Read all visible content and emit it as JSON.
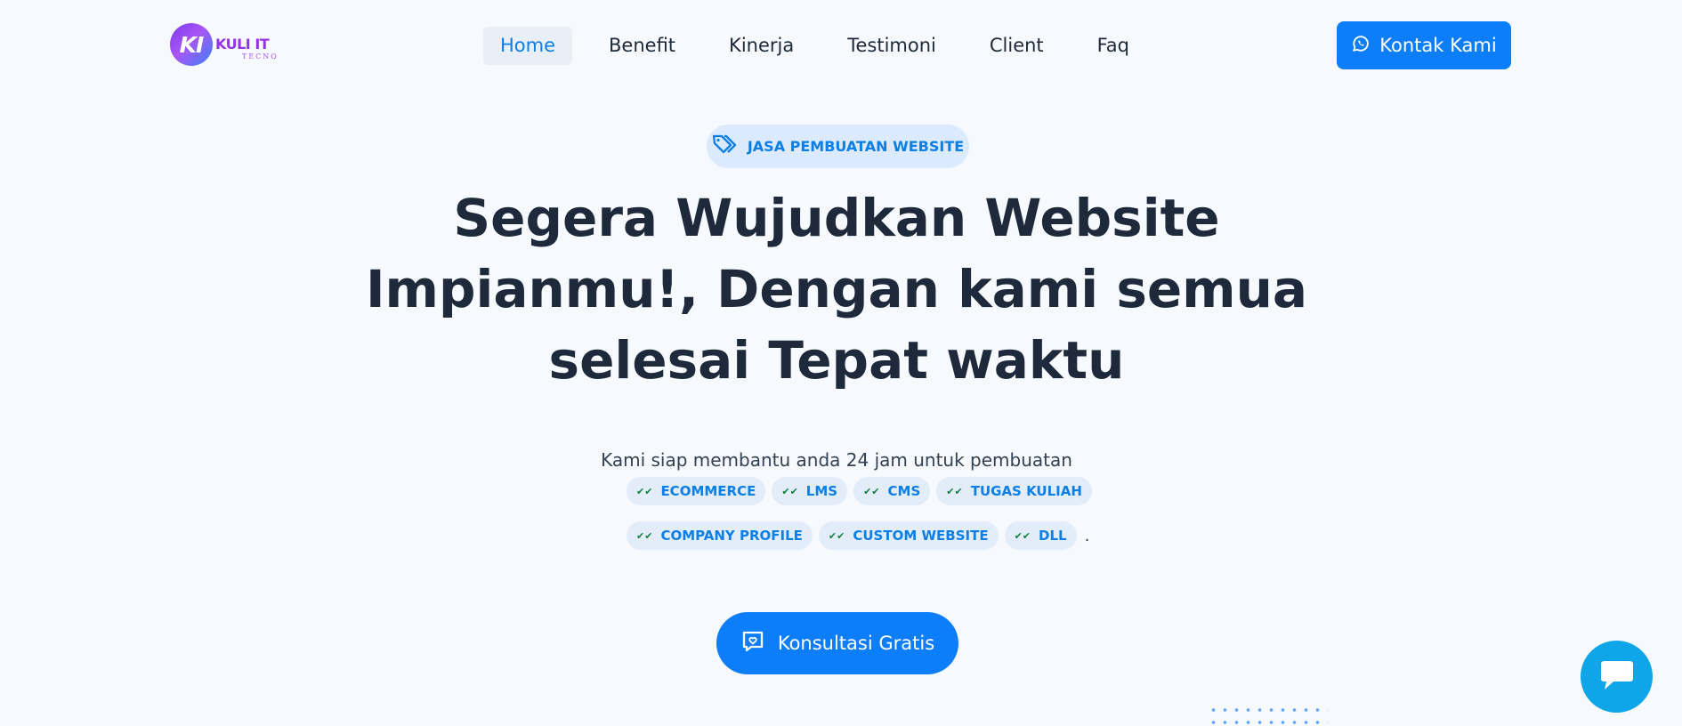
{
  "logo": {
    "mark": "KI",
    "name": "KULI IT",
    "sub": "TECNO"
  },
  "nav": {
    "items": [
      {
        "label": "Home",
        "active": true
      },
      {
        "label": "Benefit"
      },
      {
        "label": "Kinerja"
      },
      {
        "label": "Testimoni"
      },
      {
        "label": "Client"
      },
      {
        "label": "Faq"
      }
    ]
  },
  "header": {
    "contact_label": "Kontak Kami",
    "contact_icon": "whatsapp-icon"
  },
  "hero": {
    "badge": "JASA PEMBUATAN WEBSITE",
    "badge_icon": "tags-icon",
    "headline": "Segera Wujudkan Website Impianmu!, Dengan kami semua selesai Tepat waktu",
    "subtitle": "Kami siap membantu anda 24 jam untuk pembuatan",
    "tags": [
      "ECOMMERCE",
      "LMS",
      "CMS",
      "TUGAS KULIAH",
      "COMPANY PROFILE",
      "CUSTOM WEBSITE",
      "DLL"
    ],
    "trailing": ".",
    "cta_label": "Konsultasi Gratis",
    "cta_icon": "message-heart-icon"
  },
  "chat": {
    "icon": "chat-icon"
  },
  "colors": {
    "accent": "#0d7efb",
    "chat": "#0ea5e9",
    "background": "#f6f9fe"
  }
}
